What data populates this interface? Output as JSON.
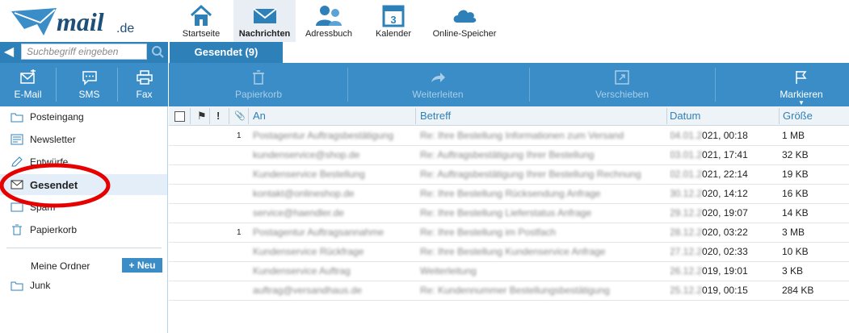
{
  "brand": {
    "logo_text": "mail",
    "logo_suffix": ".de"
  },
  "nav": [
    {
      "label": "Startseite",
      "icon": "home-icon"
    },
    {
      "label": "Nachrichten",
      "icon": "envelope-icon",
      "active": true
    },
    {
      "label": "Adressbuch",
      "icon": "contacts-icon"
    },
    {
      "label": "Kalender",
      "icon": "calendar-icon",
      "day": "3"
    },
    {
      "label": "Online-Speicher",
      "icon": "cloud-icon"
    }
  ],
  "search": {
    "placeholder": "Suchbegriff eingeben"
  },
  "left_actions": [
    {
      "label": "E-Mail",
      "icon": "compose-mail-icon"
    },
    {
      "label": "SMS",
      "icon": "sms-icon"
    },
    {
      "label": "Fax",
      "icon": "printer-icon"
    }
  ],
  "folders": [
    {
      "label": "Posteingang",
      "icon": "folder-icon"
    },
    {
      "label": "Newsletter",
      "icon": "newsletter-icon"
    },
    {
      "label": "Entwürfe",
      "icon": "draft-icon"
    },
    {
      "label": "Gesendet",
      "icon": "envelope-icon",
      "active": true
    },
    {
      "label": "Spam",
      "icon": "spam-icon"
    },
    {
      "label": "Papierkorb",
      "icon": "trash-icon"
    }
  ],
  "my_folders": {
    "label": "Meine Ordner",
    "add_label": "+ Neu",
    "items": [
      {
        "label": "Junk",
        "icon": "folder-icon"
      }
    ]
  },
  "tab": {
    "label": "Gesendet (9)"
  },
  "toolbar": [
    {
      "label": "Papierkorb",
      "icon": "trash-icon",
      "enabled": false
    },
    {
      "label": "Weiterleiten",
      "icon": "forward-icon",
      "enabled": false
    },
    {
      "label": "Verschieben",
      "icon": "move-icon",
      "enabled": false
    },
    {
      "label": "Markieren",
      "icon": "flag-icon",
      "enabled": true
    }
  ],
  "table": {
    "headers": {
      "flag": "⚑",
      "priority": "!",
      "attachment": "📎",
      "to": "An",
      "subject": "Betreff",
      "date": "Datum",
      "size": "Größe"
    },
    "rows": [
      {
        "att": "1",
        "to": "Postagentur Auftragsbestätigung",
        "subject": "Re: Ihre Bestellung Informationen zum Versand",
        "date_pre": "04.01.2",
        "date": "021, 00:18",
        "size": "1 MB"
      },
      {
        "att": "",
        "to": "kundenservice@shop.de",
        "subject": "Re: Auftragsbestätigung Ihrer Bestellung",
        "date_pre": "03.01.2",
        "date": "021, 17:41",
        "size": "32 KB"
      },
      {
        "att": "",
        "to": "Kundenservice Bestellung",
        "subject": "Re: Auftragsbestätigung Ihrer Bestellung Rechnung",
        "date_pre": "02.01.2",
        "date": "021, 22:14",
        "size": "19 KB"
      },
      {
        "att": "",
        "to": "kontakt@onlineshop.de",
        "subject": "Re: Ihre Bestellung Rücksendung Anfrage",
        "date_pre": "30.12.2",
        "date": "020, 14:12",
        "size": "16 KB"
      },
      {
        "att": "",
        "to": "service@haendler.de",
        "subject": "Re: Ihre Bestellung Lieferstatus Anfrage",
        "date_pre": "29.12.2",
        "date": "020, 19:07",
        "size": "14 KB"
      },
      {
        "att": "1",
        "to": "Postagentur Auftragsannahme",
        "subject": "Re: Ihre Bestellung im Postfach",
        "date_pre": "28.12.2",
        "date": "020, 03:22",
        "size": "3 MB"
      },
      {
        "att": "",
        "to": "Kundenservice Rückfrage",
        "subject": "Re: Ihre Bestellung Kundenservice Anfrage",
        "date_pre": "27.12.2",
        "date": "020, 02:33",
        "size": "10 KB"
      },
      {
        "att": "",
        "to": "Kundenservice Auftrag",
        "subject": "Weiterleitung",
        "date_pre": "26.12.2",
        "date": "019, 19:01",
        "size": "3 KB"
      },
      {
        "att": "",
        "to": "auftrag@versandhaus.de",
        "subject": "Re: Kundennummer Bestellungsbestätigung",
        "date_pre": "25.12.2",
        "date": "019, 00:15",
        "size": "284 KB"
      }
    ]
  },
  "colors": {
    "primary_blue": "#3a8dc7",
    "tab_blue": "#2e80b8",
    "annotation_red": "#e60000"
  }
}
